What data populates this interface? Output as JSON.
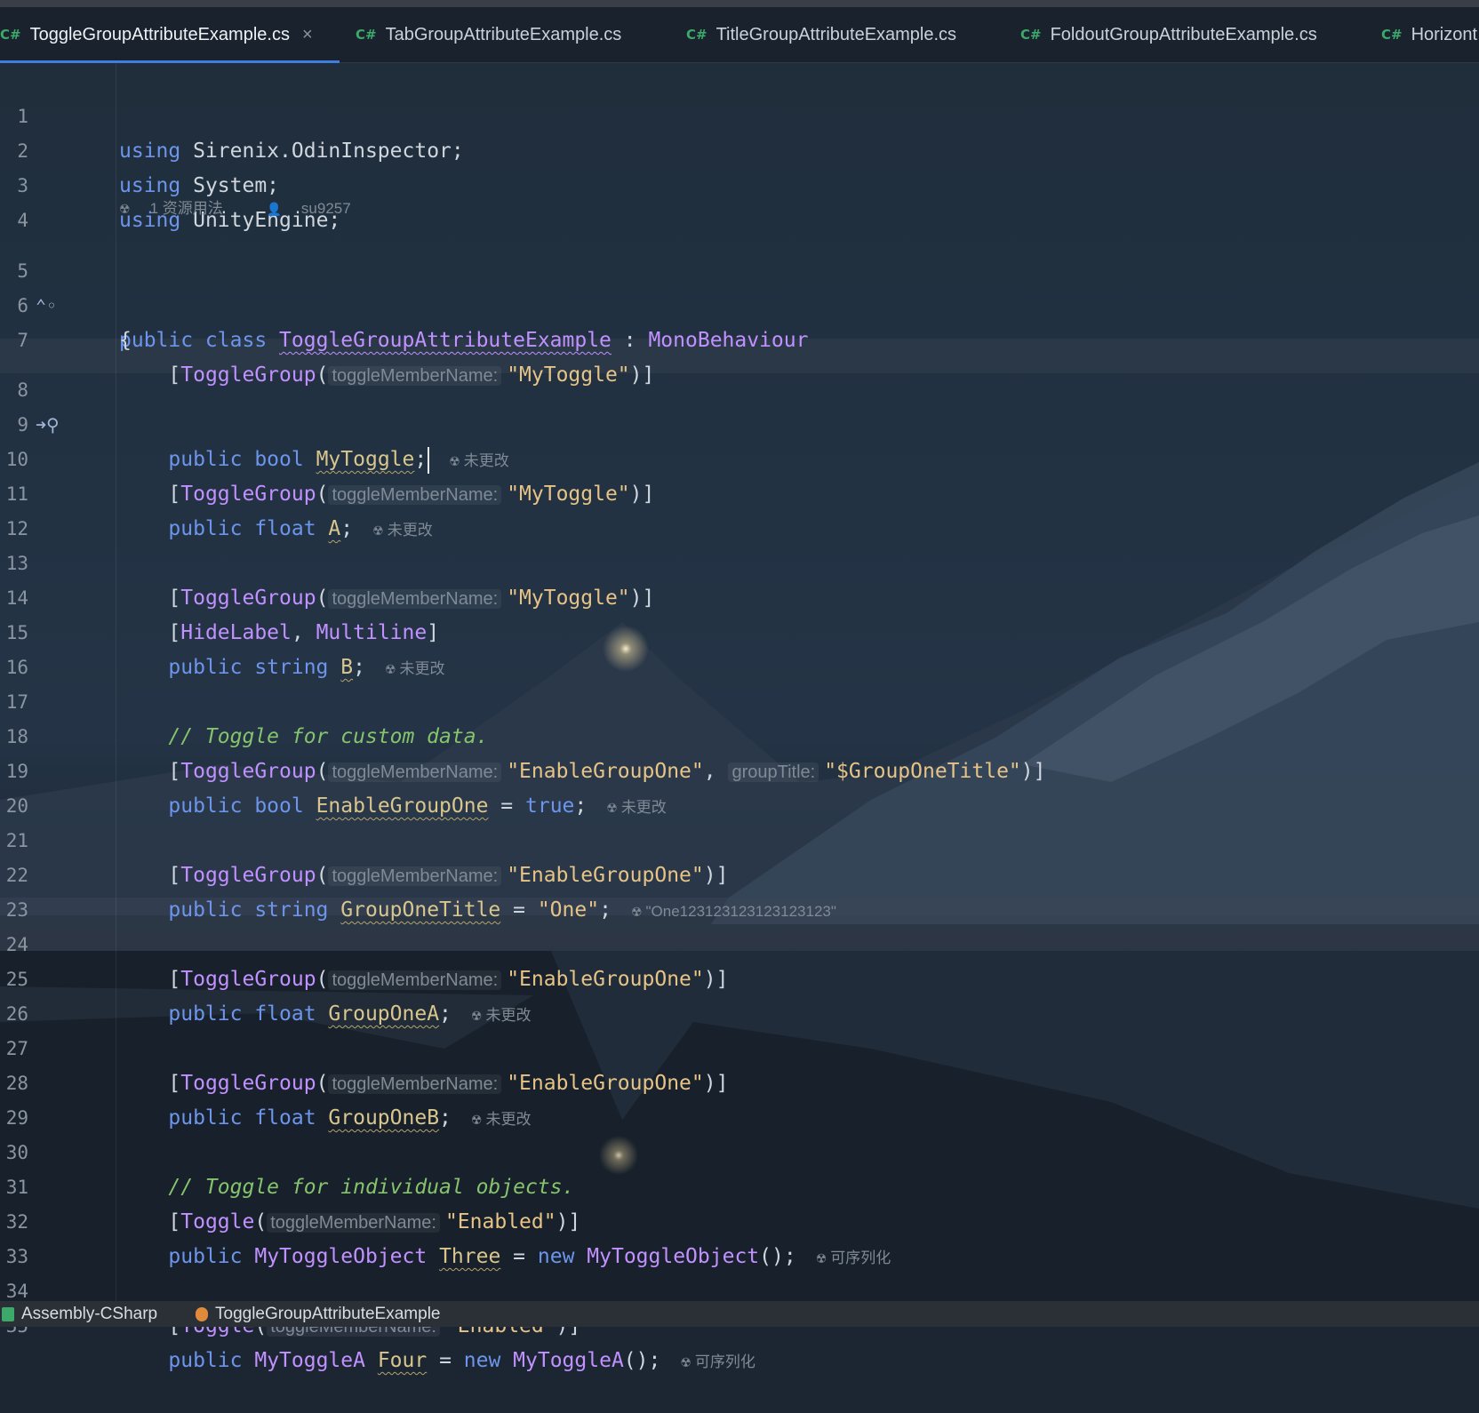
{
  "tabs": [
    {
      "lang": "C#",
      "label": "ToggleGroupAttributeExample.cs",
      "active": true
    },
    {
      "lang": "C#",
      "label": "TabGroupAttributeExample.cs"
    },
    {
      "lang": "C#",
      "label": "TitleGroupAttributeExample.cs"
    },
    {
      "lang": "C#",
      "label": "FoldoutGroupAttributeExample.cs"
    },
    {
      "lang": "C#",
      "label": "Horizont"
    }
  ],
  "close_glyph": "×",
  "usage_lens": {
    "usages": "1 资源用法",
    "author": "su9257"
  },
  "lines": {
    "l1": {
      "n": "1",
      "kw": "using",
      "rest": " Sirenix.OdinInspector;"
    },
    "l2": {
      "n": "2",
      "kw": "using",
      "rest": " System;"
    },
    "l3": {
      "n": "3",
      "kw": "using",
      "rest": " UnityEngine;"
    },
    "l4": {
      "n": "4"
    },
    "l5": {
      "n": "5",
      "kw": "public class",
      "cls": "ToggleGroupAttributeExample",
      "sep": " : ",
      "base": "MonoBehaviour"
    },
    "l6": {
      "n": "6",
      "text": "{"
    },
    "l7": {
      "n": "7",
      "attr": "ToggleGroup",
      "hint": "toggleMemberName:",
      "str": "\"MyToggle\""
    },
    "l8": {
      "n": "8",
      "kw": "public bool",
      "fld": "MyToggle",
      "lens": "未更改"
    },
    "l9": {
      "n": "9"
    },
    "l10": {
      "n": "10",
      "attr": "ToggleGroup",
      "hint": "toggleMemberName:",
      "str": "\"MyToggle\""
    },
    "l11": {
      "n": "11",
      "kw": "public float",
      "fld": "A",
      "lens": "未更改"
    },
    "l12": {
      "n": "12"
    },
    "l13": {
      "n": "13",
      "attr": "ToggleGroup",
      "hint": "toggleMemberName:",
      "str": "\"MyToggle\""
    },
    "l14": {
      "n": "14",
      "a1": "HideLabel",
      "a2": "Multiline"
    },
    "l15": {
      "n": "15",
      "kw": "public string",
      "fld": "B",
      "lens": "未更改"
    },
    "l16": {
      "n": "16"
    },
    "l17": {
      "n": "17",
      "comment": "// Toggle for custom data."
    },
    "l18": {
      "n": "18",
      "attr": "ToggleGroup",
      "hint": "toggleMemberName:",
      "str": "\"EnableGroupOne\"",
      "hint2": "groupTitle:",
      "str2": "\"$GroupOneTitle\""
    },
    "l19": {
      "n": "19",
      "kw": "public bool",
      "fld": "EnableGroupOne",
      "val": "true",
      "lens": "未更改"
    },
    "l20": {
      "n": "20"
    },
    "l21": {
      "n": "21",
      "attr": "ToggleGroup",
      "hint": "toggleMemberName:",
      "str": "\"EnableGroupOne\""
    },
    "l22": {
      "n": "22",
      "kw": "public string",
      "fld": "GroupOneTitle",
      "str": "\"One\"",
      "lens": "\"One123123123123123123\""
    },
    "l23": {
      "n": "23"
    },
    "l24": {
      "n": "24",
      "attr": "ToggleGroup",
      "hint": "toggleMemberName:",
      "str": "\"EnableGroupOne\""
    },
    "l25": {
      "n": "25",
      "kw": "public float",
      "fld": "GroupOneA",
      "lens": "未更改"
    },
    "l26": {
      "n": "26"
    },
    "l27": {
      "n": "27",
      "attr": "ToggleGroup",
      "hint": "toggleMemberName:",
      "str": "\"EnableGroupOne\""
    },
    "l28": {
      "n": "28",
      "kw": "public float",
      "fld": "GroupOneB",
      "lens": "未更改"
    },
    "l29": {
      "n": "29"
    },
    "l30": {
      "n": "30",
      "comment": "// Toggle for individual objects."
    },
    "l31": {
      "n": "31",
      "attr": "Toggle",
      "hint": "toggleMemberName:",
      "str": "\"Enabled\""
    },
    "l32": {
      "n": "32",
      "kw": "public",
      "ty": "MyToggleObject",
      "fld": "Three",
      "kw2": "new",
      "ty2": "MyToggleObject",
      "lens": "可序列化"
    },
    "l33": {
      "n": "33"
    },
    "l34": {
      "n": "34",
      "attr": "Toggle",
      "hint": "toggleMemberName:",
      "str": "\"Enabled\""
    },
    "l35": {
      "n": "35",
      "kw": "public",
      "ty": "MyToggleA",
      "fld": "Four",
      "kw2": "new",
      "ty2": "MyToggleA",
      "lens": "可序列化"
    }
  },
  "statusbar": {
    "project": "Assembly-CSharp",
    "class": "ToggleGroupAttributeExample"
  },
  "colors": {
    "keyword": "#6c95eb",
    "type": "#c191ff",
    "field": "#d8c68d",
    "string": "#e6c386",
    "comment": "#85c46c",
    "accent": "#3d7ee0",
    "csharp_badge": "#3ca86a"
  }
}
